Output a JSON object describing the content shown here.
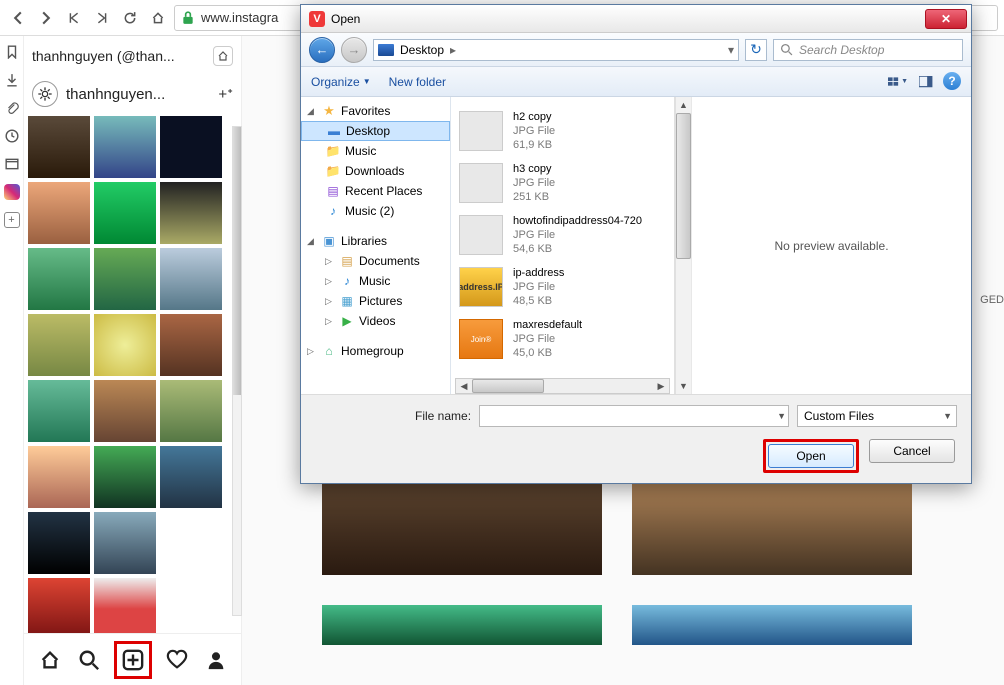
{
  "browser": {
    "url": "www.instagra",
    "lock_color": "#2ea44f"
  },
  "panel": {
    "breadcrumb": "thanhnguyen (@than...",
    "username": "thanhnguyen...",
    "add_symbol": "+ᐩ"
  },
  "dialog": {
    "title": "Open",
    "nav": {
      "breadcrumb_item": "Desktop",
      "search_placeholder": "Search Desktop"
    },
    "toolbar": {
      "organize": "Organize",
      "newfolder": "New folder"
    },
    "tree": {
      "favorites": "Favorites",
      "desktop": "Desktop",
      "music": "Music",
      "downloads": "Downloads",
      "recent": "Recent Places",
      "music2": "Music (2)",
      "libraries": "Libraries",
      "documents": "Documents",
      "music_lib": "Music",
      "pictures": "Pictures",
      "videos": "Videos",
      "homegroup": "Homegroup"
    },
    "files": [
      {
        "name": "h2 copy",
        "type": "JPG File",
        "size": "61,9 KB",
        "thumb": "plain"
      },
      {
        "name": "h3 copy",
        "type": "JPG File",
        "size": "251 KB",
        "thumb": "plain"
      },
      {
        "name": "howtofindipaddress04-720",
        "type": "JPG File",
        "size": "54,6 KB",
        "thumb": "plain"
      },
      {
        "name": "ip-address",
        "type": "JPG File",
        "size": "48,5 KB",
        "thumb": "ip"
      },
      {
        "name": "maxresdefault",
        "type": "JPG File",
        "size": "45,0 KB",
        "thumb": "orange"
      }
    ],
    "preview_text": "No preview available.",
    "filename_label": "File name:",
    "filetype": "Custom Files",
    "open_btn": "Open",
    "cancel_btn": "Cancel"
  },
  "ged": "GED"
}
